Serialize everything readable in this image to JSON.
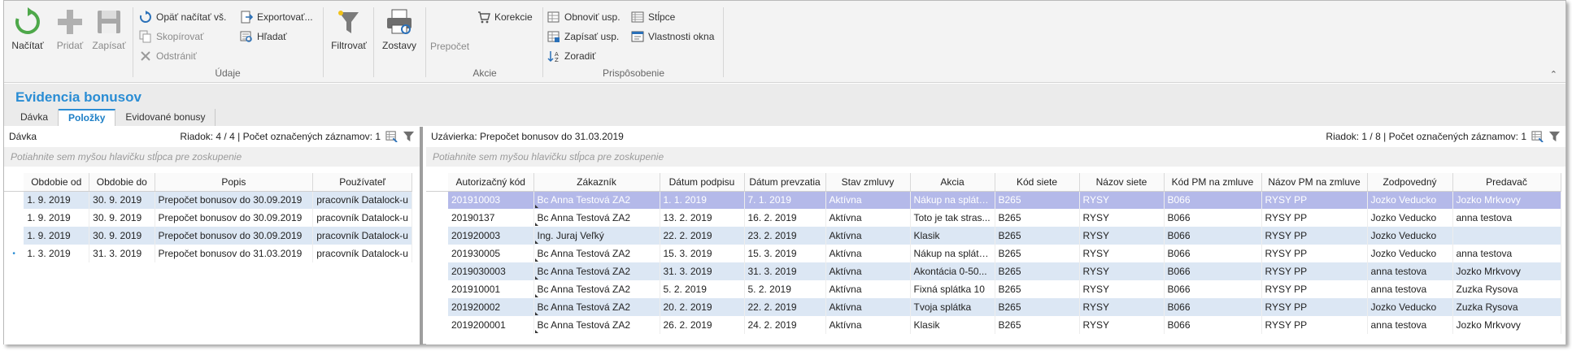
{
  "ribbon": {
    "udaje": {
      "label": "Údaje",
      "nacitat": "Načítať",
      "pridat": "Pridať",
      "zapisat": "Zapísať",
      "opat_nacitat": "Opäť načítať vš.",
      "skopirovat": "Skopírovať",
      "odstranit": "Odstrániť",
      "exportovat": "Exportovať...",
      "hladat": "Hľadať"
    },
    "filtrovat": "Filtrovať",
    "zostavy": "Zostavy",
    "akcie": {
      "label": "Akcie",
      "prepocet": "Prepočet",
      "korekcie": "Korekcie"
    },
    "prisposobenie": {
      "label": "Prispôsobenie",
      "obnovit": "Obnoviť usp.",
      "zapisat_usp": "Zapísať usp.",
      "zoradit": "Zoradiť",
      "stlpce": "Stĺpce",
      "vlastnosti": "Vlastnosti okna"
    },
    "collapse_glyph": "⌃"
  },
  "module": {
    "title": "Evidencia bonusov",
    "tabs": [
      "Dávka",
      "Položky",
      "Evidované bonusy"
    ],
    "active_tab": 1
  },
  "left_panel": {
    "title": "Dávka",
    "row_info": "Riadok: 4 / 4 | Počet označených záznamov: 1",
    "group_hint": "Potiahnite sem myšou hlavičku stĺpca pre zoskupenie",
    "columns": [
      "Obdobie od",
      "Obdobie do",
      "Popis",
      "Používateľ"
    ],
    "rows": [
      [
        "1. 9. 2019",
        "30. 9. 2019",
        "Prepočet bonusov do 30.09.2019",
        "pracovník Datalock-u"
      ],
      [
        "1. 9. 2019",
        "30. 9. 2019",
        "Prepočet bonusov do 30.09.2019",
        "pracovník Datalock-u"
      ],
      [
        "1. 9. 2019",
        "30. 9. 2019",
        "Prepočet bonusov do 30.09.2019",
        "pracovník Datalock-u"
      ],
      [
        "1. 3. 2019",
        "31. 3. 2019",
        "Prepočet bonusov do 31.03.2019",
        "pracovník Datalock-u"
      ]
    ],
    "current_row_marker": "•"
  },
  "right_panel": {
    "title": "Uzávierka: Prepočet bonusov do 31.03.2019",
    "row_info": "Riadok: 1 / 8 | Počet označených záznamov: 1",
    "group_hint": "Potiahnite sem myšou hlavičku stĺpca pre zoskupenie",
    "columns": [
      "Autorizačný kód",
      "Zákazník",
      "Dátum podpisu",
      "Dátum prevzatia",
      "Stav zmluvy",
      "Akcia",
      "Kód siete",
      "Názov siete",
      "Kód PM na zmluve",
      "Názov PM na zmluve",
      "Zodpovedný",
      "Predavač"
    ],
    "rows": [
      [
        "201910003",
        "Bc Anna  Testová ZA2",
        "1. 1. 2019",
        "7. 1. 2019",
        "Aktívna",
        "Nákup na splátk...",
        "B265",
        "RYSY",
        "B066",
        "RYSY PP",
        "Jozko Veducko",
        "Jozko Mrkvovy"
      ],
      [
        "20190137",
        "Bc Anna  Testová ZA2",
        "13. 2. 2019",
        "16. 2. 2019",
        "Aktívna",
        "Toto je tak stras...",
        "B265",
        "RYSY",
        "B066",
        "RYSY PP",
        "Jozko Veducko",
        "anna testova"
      ],
      [
        "201920003",
        "Ing. Juraj Veľký",
        "22. 2. 2019",
        "23. 2. 2019",
        "Aktívna",
        "Klasik",
        "B265",
        "RYSY",
        "B066",
        "RYSY PP",
        "Jozko Veducko",
        ""
      ],
      [
        "201930005",
        "Bc Anna  Testová ZA2",
        "15. 3. 2019",
        "15. 3. 2019",
        "Aktívna",
        "Nákup na splátk...",
        "B265",
        "RYSY",
        "B066",
        "RYSY PP",
        "Jozko Veducko",
        "anna testova"
      ],
      [
        "2019030003",
        "Bc Anna  Testová ZA2",
        "31. 3. 2019",
        "31. 3. 2019",
        "Aktívna",
        "Akontácia 0-50...",
        "B265",
        "RYSY",
        "B066",
        "RYSY PP",
        "anna testova",
        "Jozko Mrkvovy"
      ],
      [
        "201910001",
        "Bc Anna  Testová ZA2",
        "5. 2. 2019",
        "5. 2. 2019",
        "Aktívna",
        "Fixná splátka 10",
        "B265",
        "RYSY",
        "B066",
        "RYSY PP",
        "anna testova",
        "Zuzka Rysova"
      ],
      [
        "201920002",
        "Bc Anna  Testová ZA2",
        "20. 2. 2019",
        "22. 2. 2019",
        "Aktívna",
        "Tvoja splátka",
        "B265",
        "RYSY",
        "B066",
        "RYSY PP",
        "Jozko Veducko",
        "Zuzka Rysova"
      ],
      [
        "2019200001",
        "Bc Anna  Testová ZA2",
        "26. 2. 2019",
        "24. 2. 2019",
        "Aktívna",
        "Klasik",
        "B265",
        "RYSY",
        "B066",
        "RYSY PP",
        "anna testova",
        "Jozko Mrkvovy"
      ]
    ],
    "current_row_marker": "•"
  },
  "colors": {
    "accent": "#2a8dd4",
    "selected_row": "#b4b9e9",
    "alt_row": "#dce7f4"
  }
}
